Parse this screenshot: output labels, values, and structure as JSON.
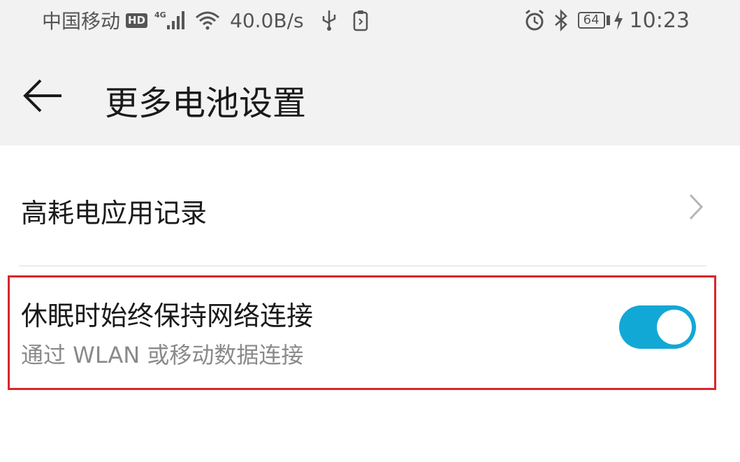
{
  "status_bar": {
    "carrier": "中国移动",
    "hd": "HD",
    "network": "4G",
    "speed": "40.0B/s",
    "battery_level": "64",
    "time": "10:23",
    "icons": [
      "signal-icon",
      "wifi-icon",
      "usb-icon",
      "clipboard-icon",
      "alarm-icon",
      "bluetooth-icon",
      "battery-icon",
      "charging-icon"
    ]
  },
  "app_bar": {
    "title": "更多电池设置",
    "back_icon": "arrow-left-icon"
  },
  "settings": [
    {
      "label": "高耗电应用记录",
      "type": "navigation",
      "icon": "chevron-right-icon"
    },
    {
      "title": "休眠时始终保持网络连接",
      "subtitle": "通过 WLAN 或移动数据连接",
      "type": "toggle",
      "enabled": true
    }
  ],
  "colors": {
    "accent": "#12a8d6",
    "highlight_border": "#d8262c",
    "header_bg": "#f2f2f2",
    "secondary_text": "#8a8a8a"
  }
}
